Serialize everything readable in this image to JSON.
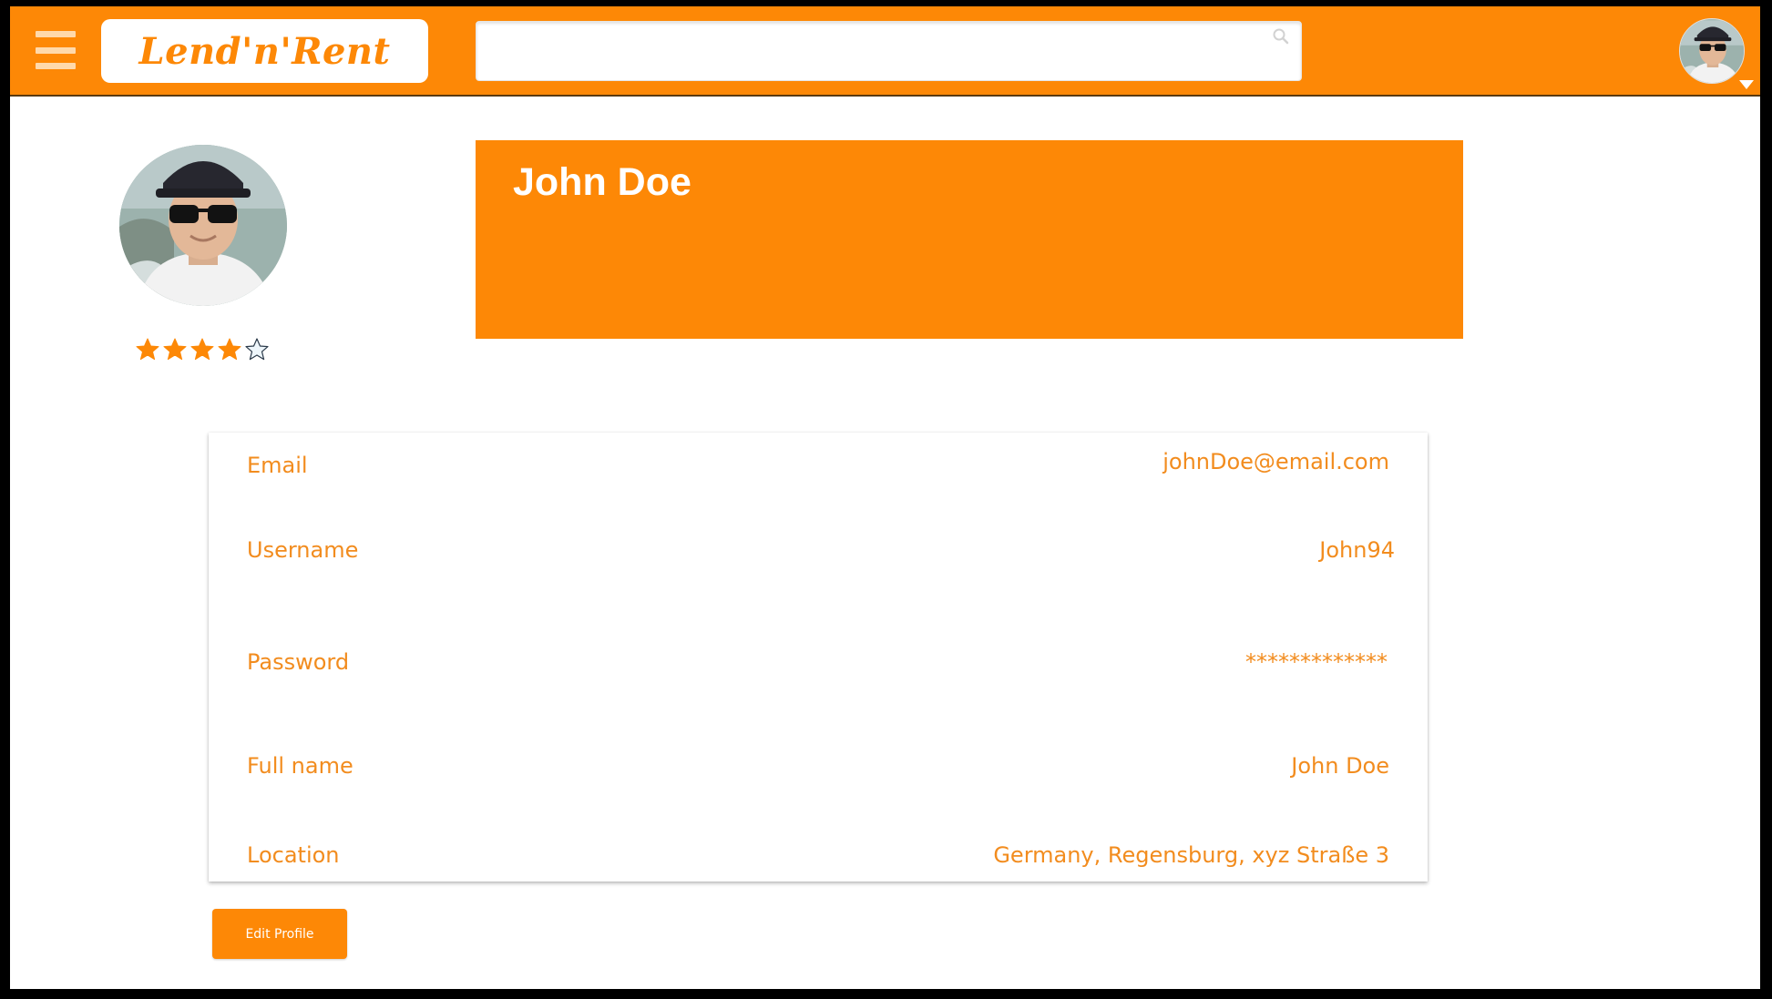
{
  "app": {
    "logo_text": "Lend'n'Rent"
  },
  "header": {
    "search": {
      "value": "",
      "placeholder": ""
    }
  },
  "profile": {
    "name": "John Doe",
    "rating": {
      "value": 4,
      "max": 5
    },
    "fields": [
      {
        "label": "Email",
        "value": "johnDoe@email.com"
      },
      {
        "label": "Username",
        "value": "John94"
      },
      {
        "label": "Password",
        "value": "*************"
      },
      {
        "label": "Full name",
        "value": "John Doe"
      },
      {
        "label": "Location",
        "value": "Germany, Regensburg, xyz Straße 3"
      }
    ],
    "edit_button_label": "Edit Profile"
  },
  "colors": {
    "brand_orange": "#fd8806",
    "text_orange": "#f28c1e",
    "background": "#ffffff"
  },
  "icons": {
    "menu": "hamburger-icon",
    "search": "search-icon",
    "user_menu_caret": "caret-down-icon",
    "rating_star": "star-icon"
  }
}
